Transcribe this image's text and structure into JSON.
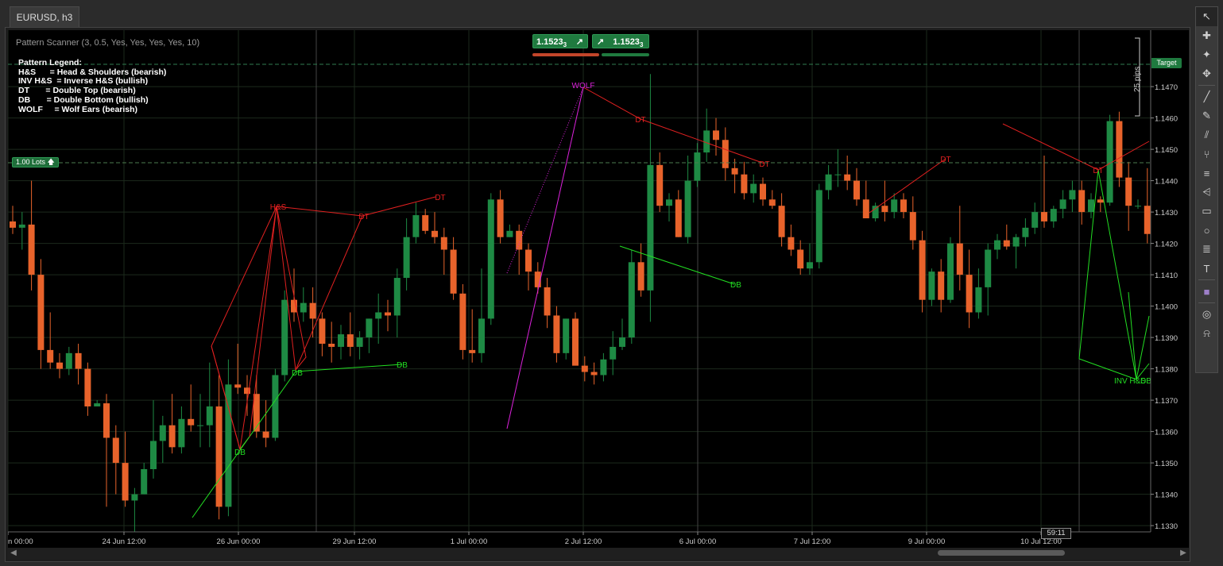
{
  "tab": {
    "label": "EURUSD, h3"
  },
  "scanner": {
    "title": "Pattern Scanner (3, 0.5, Yes, Yes, Yes, Yes, 10)"
  },
  "legend": {
    "title": "Pattern Legend:",
    "lines": [
      "H&S      = Head & Shoulders (bearish)",
      "INV H&S  = Inverse H&S (bullish)",
      "DT       = Double Top (bearish)",
      "DB       = Double Bottom (bullish)",
      "WOLF     = Wolf Ears (bearish)"
    ]
  },
  "trade": {
    "sell_price": "1.1523",
    "sell_sub": "3",
    "buy_price": "1.1523",
    "buy_sub": "3",
    "lots": "1.00 Lots",
    "target": "Target",
    "pips": "25 pips"
  },
  "timer": "59:11",
  "colors": {
    "bull": "#1e8a44",
    "bear": "#e8632b",
    "red_line": "#e02020",
    "green_line": "#22dd22",
    "wolf": "#dd22dd"
  },
  "chart_data": {
    "type": "candlestick",
    "symbol": "EURUSD",
    "timeframe": "h3",
    "ylim": [
      1.1328,
      1.1488
    ],
    "yticks": [
      "1.1330",
      "1.1340",
      "1.1350",
      "1.1360",
      "1.1370",
      "1.1380",
      "1.1390",
      "1.1400",
      "1.1410",
      "1.1420",
      "1.1430",
      "1.1440",
      "1.1450",
      "1.1460",
      "1.1470"
    ],
    "xticks": [
      "n 00:00",
      "24 Jun 12:00",
      "26 Jun 00:00",
      "29 Jun 12:00",
      "1 Jul 00:00",
      "2 Jul 12:00",
      "6 Jul 00:00",
      "7 Jul 12:00",
      "9 Jul 00:00",
      "10 Jul 12:00"
    ],
    "candles": [
      [
        1.1427,
        1.1432,
        1.1423,
        1.1425
      ],
      [
        1.1425,
        1.143,
        1.1418,
        1.1426
      ],
      [
        1.1426,
        1.144,
        1.1405,
        1.141
      ],
      [
        1.141,
        1.1415,
        1.138,
        1.1386
      ],
      [
        1.1386,
        1.1398,
        1.138,
        1.1382
      ],
      [
        1.1382,
        1.1385,
        1.1377,
        1.138
      ],
      [
        1.138,
        1.1387,
        1.1378,
        1.1385
      ],
      [
        1.1385,
        1.1388,
        1.1375,
        1.138
      ],
      [
        1.138,
        1.1382,
        1.1365,
        1.1368
      ],
      [
        1.1368,
        1.137,
        1.1368,
        1.1369
      ],
      [
        1.1369,
        1.1372,
        1.1336,
        1.1358
      ],
      [
        1.1358,
        1.1362,
        1.134,
        1.135
      ],
      [
        1.135,
        1.136,
        1.1336,
        1.1338
      ],
      [
        1.1338,
        1.1342,
        1.1328,
        1.134
      ],
      [
        1.134,
        1.135,
        1.134,
        1.1348
      ],
      [
        1.1348,
        1.137,
        1.1345,
        1.1357
      ],
      [
        1.1357,
        1.1365,
        1.135,
        1.1362
      ],
      [
        1.1362,
        1.1372,
        1.1353,
        1.1355
      ],
      [
        1.1355,
        1.1368,
        1.1353,
        1.1364
      ],
      [
        1.1364,
        1.1375,
        1.136,
        1.1362
      ],
      [
        1.1362,
        1.1372,
        1.1355,
        1.1362
      ],
      [
        1.1362,
        1.1382,
        1.1355,
        1.1368
      ],
      [
        1.1368,
        1.1378,
        1.1332,
        1.1336
      ],
      [
        1.1336,
        1.1383,
        1.1333,
        1.1375
      ],
      [
        1.1375,
        1.1388,
        1.1372,
        1.1374
      ],
      [
        1.1374,
        1.1378,
        1.1365,
        1.1372
      ],
      [
        1.1372,
        1.1378,
        1.1358,
        1.136
      ],
      [
        1.136,
        1.137,
        1.1355,
        1.1358
      ],
      [
        1.1358,
        1.138,
        1.1357,
        1.1378
      ],
      [
        1.1378,
        1.1405,
        1.1376,
        1.1402
      ],
      [
        1.1402,
        1.1412,
        1.1395,
        1.1398
      ],
      [
        1.1398,
        1.1406,
        1.1395,
        1.1401
      ],
      [
        1.1401,
        1.1406,
        1.139,
        1.1396
      ],
      [
        1.1396,
        1.1398,
        1.1384,
        1.1388
      ],
      [
        1.1388,
        1.1395,
        1.1382,
        1.1387
      ],
      [
        1.1387,
        1.1394,
        1.1383,
        1.1391
      ],
      [
        1.1391,
        1.1398,
        1.1384,
        1.1387
      ],
      [
        1.1387,
        1.1392,
        1.1383,
        1.139
      ],
      [
        1.139,
        1.1396,
        1.1385,
        1.1396
      ],
      [
        1.1396,
        1.1404,
        1.1388,
        1.1398
      ],
      [
        1.1398,
        1.1402,
        1.1392,
        1.1397
      ],
      [
        1.1397,
        1.1412,
        1.139,
        1.1409
      ],
      [
        1.1409,
        1.1428,
        1.1405,
        1.1422
      ],
      [
        1.1422,
        1.1433,
        1.142,
        1.1429
      ],
      [
        1.1429,
        1.1431,
        1.1423,
        1.1424
      ],
      [
        1.1424,
        1.143,
        1.142,
        1.1422
      ],
      [
        1.1422,
        1.1425,
        1.141,
        1.1418
      ],
      [
        1.1418,
        1.1422,
        1.1402,
        1.1404
      ],
      [
        1.1404,
        1.1407,
        1.1383,
        1.1386
      ],
      [
        1.1386,
        1.1399,
        1.1382,
        1.1385
      ],
      [
        1.1385,
        1.1412,
        1.1382,
        1.1396
      ],
      [
        1.1396,
        1.1436,
        1.1394,
        1.1434
      ],
      [
        1.1434,
        1.1437,
        1.142,
        1.1422
      ],
      [
        1.1422,
        1.1426,
        1.1422,
        1.1424
      ],
      [
        1.1424,
        1.1426,
        1.141,
        1.1418
      ],
      [
        1.1418,
        1.142,
        1.1405,
        1.1411
      ],
      [
        1.1411,
        1.1414,
        1.1404,
        1.1406
      ],
      [
        1.1406,
        1.1409,
        1.1393,
        1.1397
      ],
      [
        1.1397,
        1.14,
        1.1382,
        1.1385
      ],
      [
        1.1385,
        1.1396,
        1.1383,
        1.1396
      ],
      [
        1.1396,
        1.1398,
        1.1382,
        1.1381
      ],
      [
        1.1381,
        1.1384,
        1.1376,
        1.1379
      ],
      [
        1.1379,
        1.1382,
        1.1375,
        1.1378
      ],
      [
        1.1378,
        1.1385,
        1.1376,
        1.1383
      ],
      [
        1.1383,
        1.1392,
        1.1378,
        1.1387
      ],
      [
        1.1387,
        1.1396,
        1.1386,
        1.139
      ],
      [
        1.139,
        1.1418,
        1.1388,
        1.1414
      ],
      [
        1.1414,
        1.142,
        1.1403,
        1.1405
      ],
      [
        1.1405,
        1.1474,
        1.1395,
        1.1445
      ],
      [
        1.1445,
        1.1449,
        1.143,
        1.1432
      ],
      [
        1.1432,
        1.1436,
        1.1427,
        1.1434
      ],
      [
        1.1434,
        1.1437,
        1.1422,
        1.1422
      ],
      [
        1.1422,
        1.1448,
        1.142,
        1.144
      ],
      [
        1.144,
        1.1452,
        1.1438,
        1.1449
      ],
      [
        1.1449,
        1.1463,
        1.1446,
        1.1456
      ],
      [
        1.1456,
        1.146,
        1.1448,
        1.1453
      ],
      [
        1.1453,
        1.1457,
        1.144,
        1.1444
      ],
      [
        1.1444,
        1.1447,
        1.1436,
        1.1442
      ],
      [
        1.1442,
        1.1446,
        1.1434,
        1.1436
      ],
      [
        1.1436,
        1.1442,
        1.1433,
        1.1439
      ],
      [
        1.1439,
        1.1441,
        1.1432,
        1.1434
      ],
      [
        1.1434,
        1.1437,
        1.1431,
        1.1432
      ],
      [
        1.1432,
        1.1436,
        1.1419,
        1.1422
      ],
      [
        1.1422,
        1.1426,
        1.1416,
        1.1418
      ],
      [
        1.1418,
        1.1421,
        1.141,
        1.1412
      ],
      [
        1.1412,
        1.142,
        1.141,
        1.1414
      ],
      [
        1.1414,
        1.1439,
        1.1412,
        1.1437
      ],
      [
        1.1437,
        1.1445,
        1.1434,
        1.1442
      ],
      [
        1.1442,
        1.145,
        1.1438,
        1.1442
      ],
      [
        1.1442,
        1.1448,
        1.1437,
        1.144
      ],
      [
        1.144,
        1.1444,
        1.1432,
        1.1434
      ],
      [
        1.1434,
        1.144,
        1.1432,
        1.1428
      ],
      [
        1.1428,
        1.1433,
        1.1427,
        1.1432
      ],
      [
        1.1432,
        1.144,
        1.1427,
        1.143
      ],
      [
        1.143,
        1.1436,
        1.1428,
        1.1434
      ],
      [
        1.1434,
        1.1436,
        1.1428,
        1.143
      ],
      [
        1.143,
        1.1435,
        1.1418,
        1.1421
      ],
      [
        1.1421,
        1.1424,
        1.1398,
        1.1402
      ],
      [
        1.1402,
        1.1412,
        1.14,
        1.1411
      ],
      [
        1.1411,
        1.1415,
        1.1398,
        1.1402
      ],
      [
        1.1402,
        1.1422,
        1.1401,
        1.142
      ],
      [
        1.142,
        1.1432,
        1.1405,
        1.141
      ],
      [
        1.141,
        1.1418,
        1.1393,
        1.1398
      ],
      [
        1.1398,
        1.1412,
        1.1396,
        1.1406
      ],
      [
        1.1406,
        1.142,
        1.1397,
        1.1418
      ],
      [
        1.1418,
        1.1423,
        1.1415,
        1.1421
      ],
      [
        1.1421,
        1.1426,
        1.1418,
        1.1419
      ],
      [
        1.1419,
        1.1423,
        1.1412,
        1.1422
      ],
      [
        1.1422,
        1.1428,
        1.1419,
        1.1425
      ],
      [
        1.1425,
        1.1433,
        1.1423,
        1.143
      ],
      [
        1.143,
        1.1448,
        1.1425,
        1.1427
      ],
      [
        1.1427,
        1.1432,
        1.1425,
        1.1431
      ],
      [
        1.1431,
        1.1437,
        1.1428,
        1.1434
      ],
      [
        1.1434,
        1.144,
        1.143,
        1.1437
      ],
      [
        1.1437,
        1.144,
        1.1426,
        1.143
      ],
      [
        1.143,
        1.1436,
        1.1428,
        1.1434
      ],
      [
        1.1434,
        1.1435,
        1.143,
        1.1433
      ],
      [
        1.1433,
        1.1461,
        1.1432,
        1.1459
      ],
      [
        1.1459,
        1.1462,
        1.1438,
        1.1441
      ],
      [
        1.1441,
        1.1446,
        1.1424,
        1.1432
      ],
      [
        1.1432,
        1.1434,
        1.1431,
        1.1432
      ],
      [
        1.1432,
        1.1444,
        1.142,
        1.1423
      ],
      [
        1.1423,
        1.1427,
        1.1415,
        1.1418
      ],
      [
        1.1418,
        1.1423,
        1.1414,
        1.1416
      ],
      [
        1.1416,
        1.142,
        1.1412,
        1.1413
      ],
      [
        1.1404,
        1.1406,
        1.1396,
        1.1406
      ],
      [
        1.1406,
        1.1407,
        1.1392,
        1.1396
      ],
      [
        1.1396,
        1.1403,
        1.1388,
        1.1398
      ],
      [
        1.1398,
        1.1446,
        1.1396,
        1.1436
      ],
      [
        1.1436,
        1.1437,
        1.1424,
        1.1428
      ],
      [
        1.1428,
        1.1433,
        1.139,
        1.1396
      ],
      [
        1.1396,
        1.1402,
        1.1387,
        1.1381
      ],
      [
        1.1381,
        1.1389,
        1.1378,
        1.1387
      ],
      [
        1.1387,
        1.1401,
        1.1384,
        1.1385
      ]
    ],
    "patterns": [
      {
        "label": "H&S",
        "color": "#e02020"
      },
      {
        "label": "DT",
        "color": "#e02020"
      },
      {
        "label": "DT",
        "color": "#e02020"
      },
      {
        "label": "DB",
        "color": "#22dd22"
      },
      {
        "label": "DB",
        "color": "#22dd22"
      },
      {
        "label": "DB",
        "color": "#22dd22"
      },
      {
        "label": "WOLF",
        "color": "#dd22dd"
      },
      {
        "label": "DT",
        "color": "#e02020"
      },
      {
        "label": "DT",
        "color": "#e02020"
      },
      {
        "label": "DB",
        "color": "#22dd22"
      },
      {
        "label": "DT",
        "color": "#e02020"
      },
      {
        "label": "DT",
        "color": "#e02020"
      },
      {
        "label": "INV H&S",
        "color": "#22dd22"
      },
      {
        "label": "DB",
        "color": "#22dd22"
      }
    ]
  },
  "toolbar": {
    "tools": [
      "cursor-icon",
      "crosshair-icon",
      "crosshair-plus-icon",
      "move-icon",
      "trend-line-icon",
      "pen-icon",
      "channel-icon",
      "fork-icon",
      "fibonacci-icon",
      "fan-icon",
      "rectangle-icon",
      "ellipse-icon",
      "text-levels-icon",
      "text-icon",
      "color-icon",
      "camera-icon",
      "bell-icon"
    ]
  }
}
